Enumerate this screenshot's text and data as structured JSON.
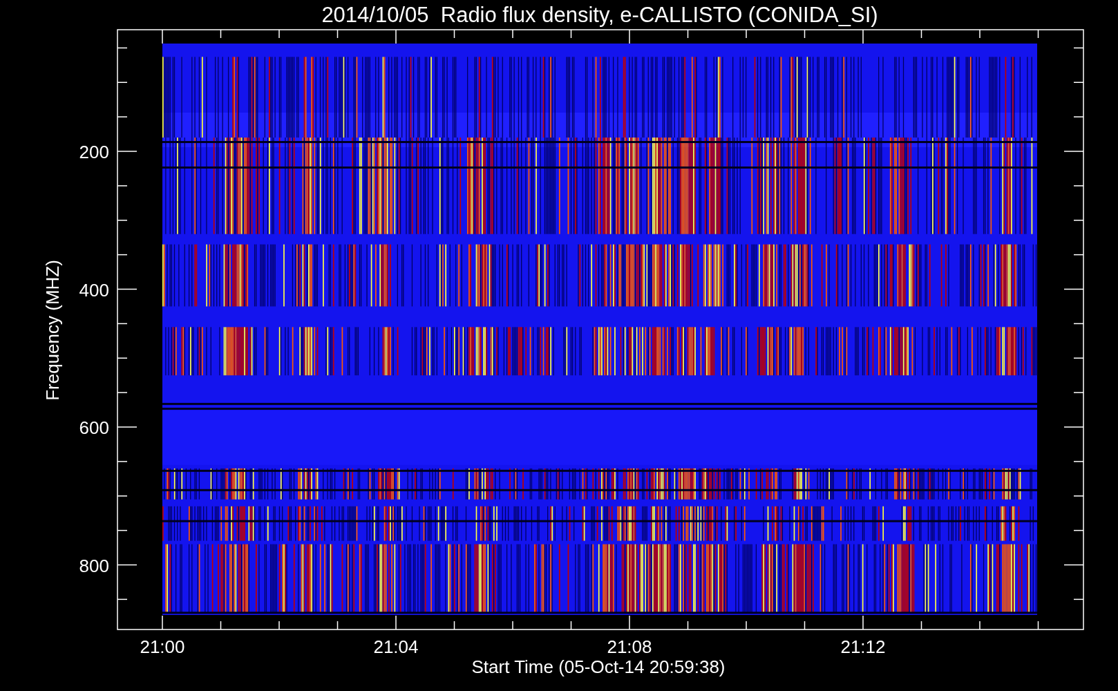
{
  "plot": {
    "title": "2014/10/05  Radio flux density, e-CALLISTO (CONIDA_SI)",
    "xlabel": "Start Time (05-Oct-14 20:59:38)",
    "ylabel": "Frequency (MHZ)",
    "xticks": [
      "21:00",
      "21:04",
      "21:08",
      "21:12"
    ],
    "yticks": [
      "200",
      "400",
      "600",
      "800"
    ]
  }
}
